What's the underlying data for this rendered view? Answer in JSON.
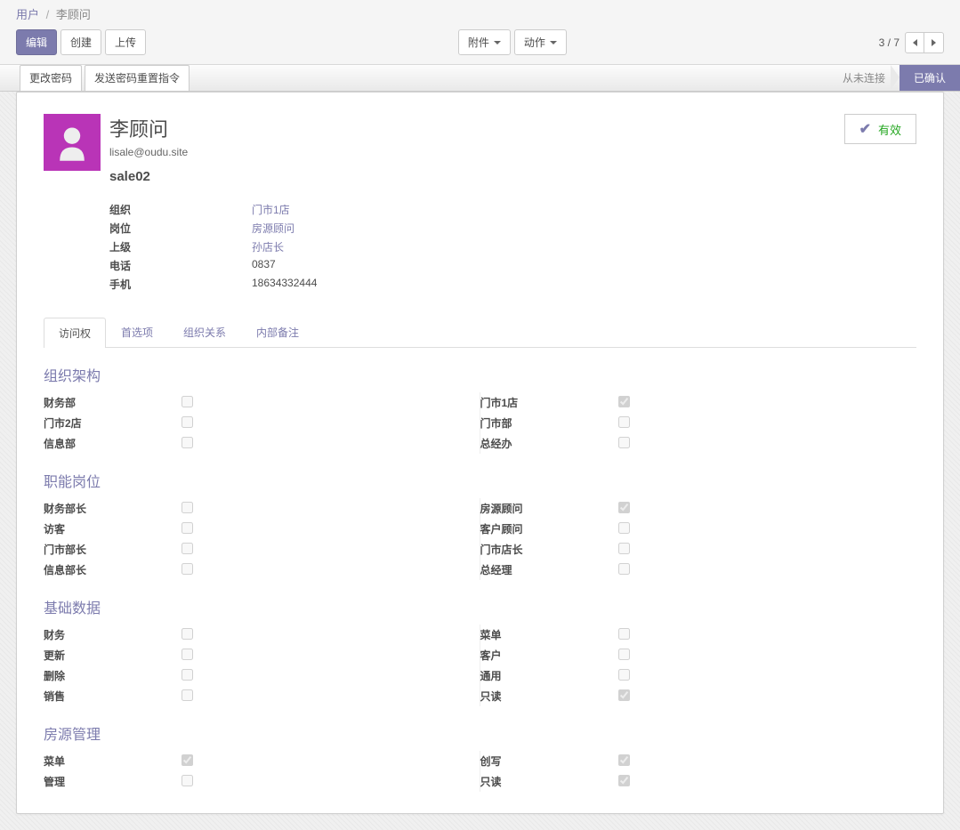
{
  "breadcrumb": {
    "root": "用户",
    "current": "李顾问"
  },
  "toolbar": {
    "edit": "编辑",
    "create": "创建",
    "upload": "上传",
    "attachments": "附件",
    "actions": "动作"
  },
  "pager": {
    "text": "3 / 7"
  },
  "actionbar": {
    "change_password": "更改密码",
    "send_reset": "发送密码重置指令"
  },
  "status": {
    "never_connected": "从未连接",
    "confirmed": "已确认"
  },
  "user": {
    "name": "李顾问",
    "email": "lisale@oudu.site",
    "login": "sale02"
  },
  "badge": {
    "label": "有效"
  },
  "fields": {
    "org_label": "组织",
    "org_value": "门市1店",
    "position_label": "岗位",
    "position_value": "房源顾问",
    "superior_label": "上级",
    "superior_value": "孙店长",
    "phone_label": "电话",
    "phone_value": "0837",
    "mobile_label": "手机",
    "mobile_value": "18634332444"
  },
  "tabs": {
    "access": "访问权",
    "preferences": "首选项",
    "org_relations": "组织关系",
    "internal_notes": "内部备注"
  },
  "sections": {
    "org_structure": {
      "title": "组织架构",
      "left": [
        {
          "label": "财务部",
          "checked": false
        },
        {
          "label": "门市2店",
          "checked": false
        },
        {
          "label": "信息部",
          "checked": false
        }
      ],
      "right": [
        {
          "label": "门市1店",
          "checked": true
        },
        {
          "label": "门市部",
          "checked": false
        },
        {
          "label": "总经办",
          "checked": false
        }
      ]
    },
    "positions": {
      "title": "职能岗位",
      "left": [
        {
          "label": "财务部长",
          "checked": false
        },
        {
          "label": "访客",
          "checked": false
        },
        {
          "label": "门市部长",
          "checked": false
        },
        {
          "label": "信息部长",
          "checked": false
        }
      ],
      "right": [
        {
          "label": "房源顾问",
          "checked": true
        },
        {
          "label": "客户顾问",
          "checked": false
        },
        {
          "label": "门市店长",
          "checked": false
        },
        {
          "label": "总经理",
          "checked": false
        }
      ]
    },
    "basic_data": {
      "title": "基础数据",
      "left": [
        {
          "label": "财务",
          "checked": false
        },
        {
          "label": "更新",
          "checked": false
        },
        {
          "label": "删除",
          "checked": false
        },
        {
          "label": "销售",
          "checked": false
        }
      ],
      "right": [
        {
          "label": "菜单",
          "checked": false
        },
        {
          "label": "客户",
          "checked": false
        },
        {
          "label": "通用",
          "checked": false
        },
        {
          "label": "只读",
          "checked": true
        }
      ]
    },
    "property_mgmt": {
      "title": "房源管理",
      "left": [
        {
          "label": "菜单",
          "checked": true
        },
        {
          "label": "管理",
          "checked": false
        }
      ],
      "right": [
        {
          "label": "创写",
          "checked": true
        },
        {
          "label": "只读",
          "checked": true
        }
      ]
    }
  }
}
